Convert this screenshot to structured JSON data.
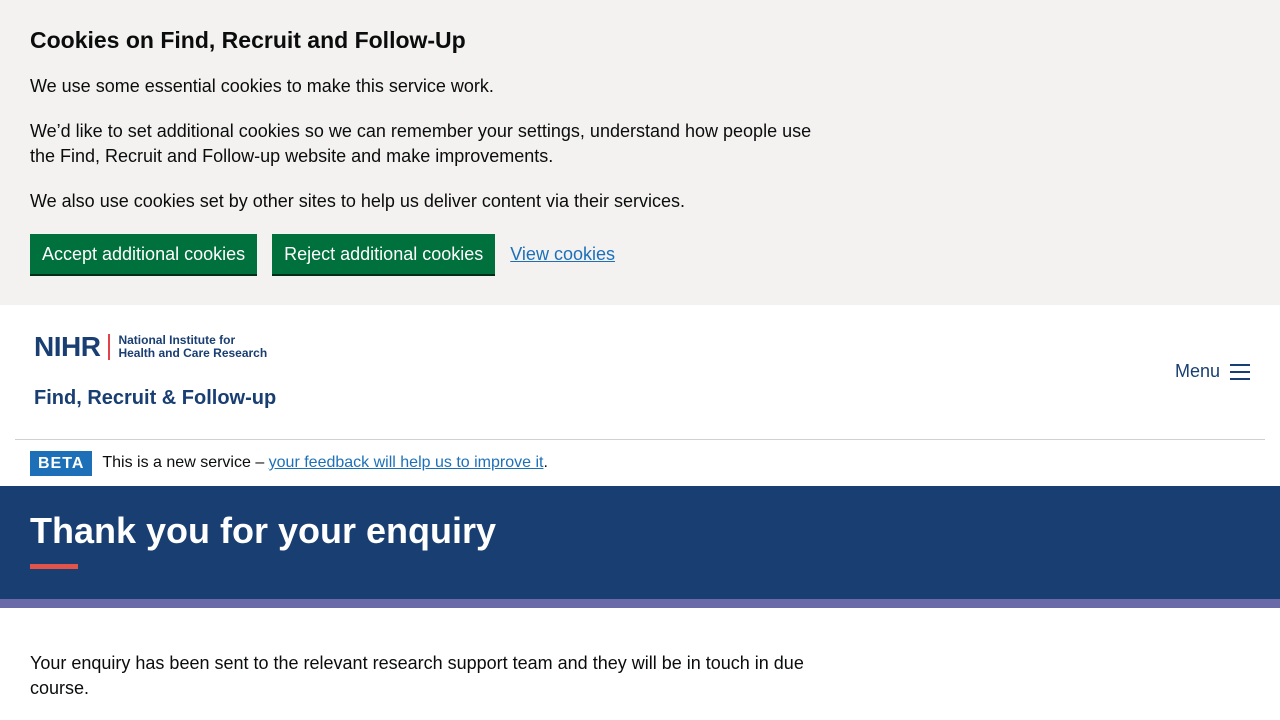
{
  "cookie": {
    "title": "Cookies on Find, Recruit and Follow-Up",
    "p1": "We use some essential cookies to make this service work.",
    "p2": "We’d like to set additional cookies so we can remember your settings, understand how people use the Find, Recruit and Follow-up website and make improvements.",
    "p3": "We also use cookies set by other sites to help us deliver content via their services.",
    "accept_label": "Accept additional cookies",
    "reject_label": "Reject additional cookies",
    "view_label": "View cookies"
  },
  "header": {
    "logo_nihr": "NIHR",
    "logo_org_line1": "National Institute for",
    "logo_org_line2": "Health and Care Research",
    "service_name": "Find, Recruit & Follow-up",
    "menu_label": "Menu"
  },
  "beta": {
    "tag": "BETA",
    "text": "This is a new service – ",
    "link": "your feedback will help us to improve it",
    "suffix": "."
  },
  "hero": {
    "title": "Thank you for your enquiry"
  },
  "main": {
    "message": "Your enquiry has been sent to the relevant research support team and they will be in touch in due course."
  },
  "colors": {
    "primary_blue": "#193e72",
    "button_green": "#00703c",
    "link_blue": "#1d70b8",
    "accent_red": "#e2534a",
    "band_purple": "#6b6aa8",
    "banner_grey": "#f3f2f1"
  }
}
